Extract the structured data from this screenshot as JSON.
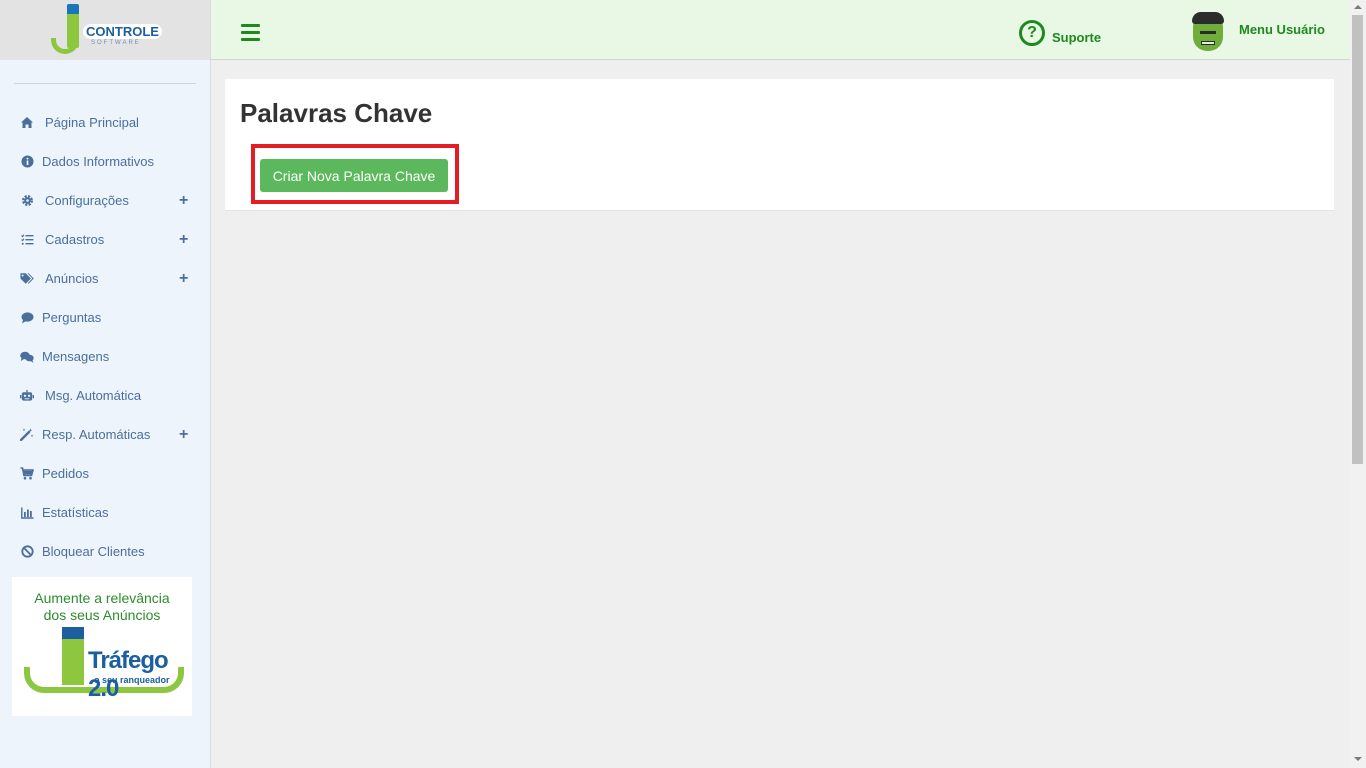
{
  "logo": {
    "text": "CONTROLE",
    "sub": "SOFTWARE"
  },
  "sidebar": {
    "items": [
      {
        "label": "Página Principal",
        "icon": "home-icon",
        "expandable": false
      },
      {
        "label": "Dados Informativos",
        "icon": "info-icon",
        "expandable": false
      },
      {
        "label": "Configurações",
        "icon": "gear-icon",
        "expandable": true
      },
      {
        "label": "Cadastros",
        "icon": "list-check-icon",
        "expandable": true
      },
      {
        "label": "Anúncios",
        "icon": "tags-icon",
        "expandable": true
      },
      {
        "label": "Perguntas",
        "icon": "comment-icon",
        "expandable": false
      },
      {
        "label": "Mensagens",
        "icon": "comments-icon",
        "expandable": false
      },
      {
        "label": "Msg. Automática",
        "icon": "robot-icon",
        "expandable": false
      },
      {
        "label": "Resp. Automáticas",
        "icon": "magic-wand-icon",
        "expandable": true
      },
      {
        "label": "Pedidos",
        "icon": "cart-icon",
        "expandable": false
      },
      {
        "label": "Estatísticas",
        "icon": "chart-bar-icon",
        "expandable": false
      },
      {
        "label": "Bloquear Clientes",
        "icon": "ban-icon",
        "expandable": false
      }
    ],
    "expand_symbol": "+"
  },
  "banner": {
    "line1": "Aumente a relevância",
    "line2": "dos seus Anúncios",
    "title": "Tráfego 2.0",
    "subtitle": "o seu ranqueador"
  },
  "topbar": {
    "support_label": "Suporte",
    "support_symbol": "?",
    "user_menu_label": "Menu Usuário"
  },
  "main": {
    "page_title": "Palavras Chave",
    "create_button_label": "Criar Nova Palavra Chave"
  },
  "colors": {
    "accent_green": "#1e8a1e",
    "button_green": "#5cb85c",
    "highlight_red": "#e21d24",
    "sidebar_text": "#4a6f9b"
  }
}
